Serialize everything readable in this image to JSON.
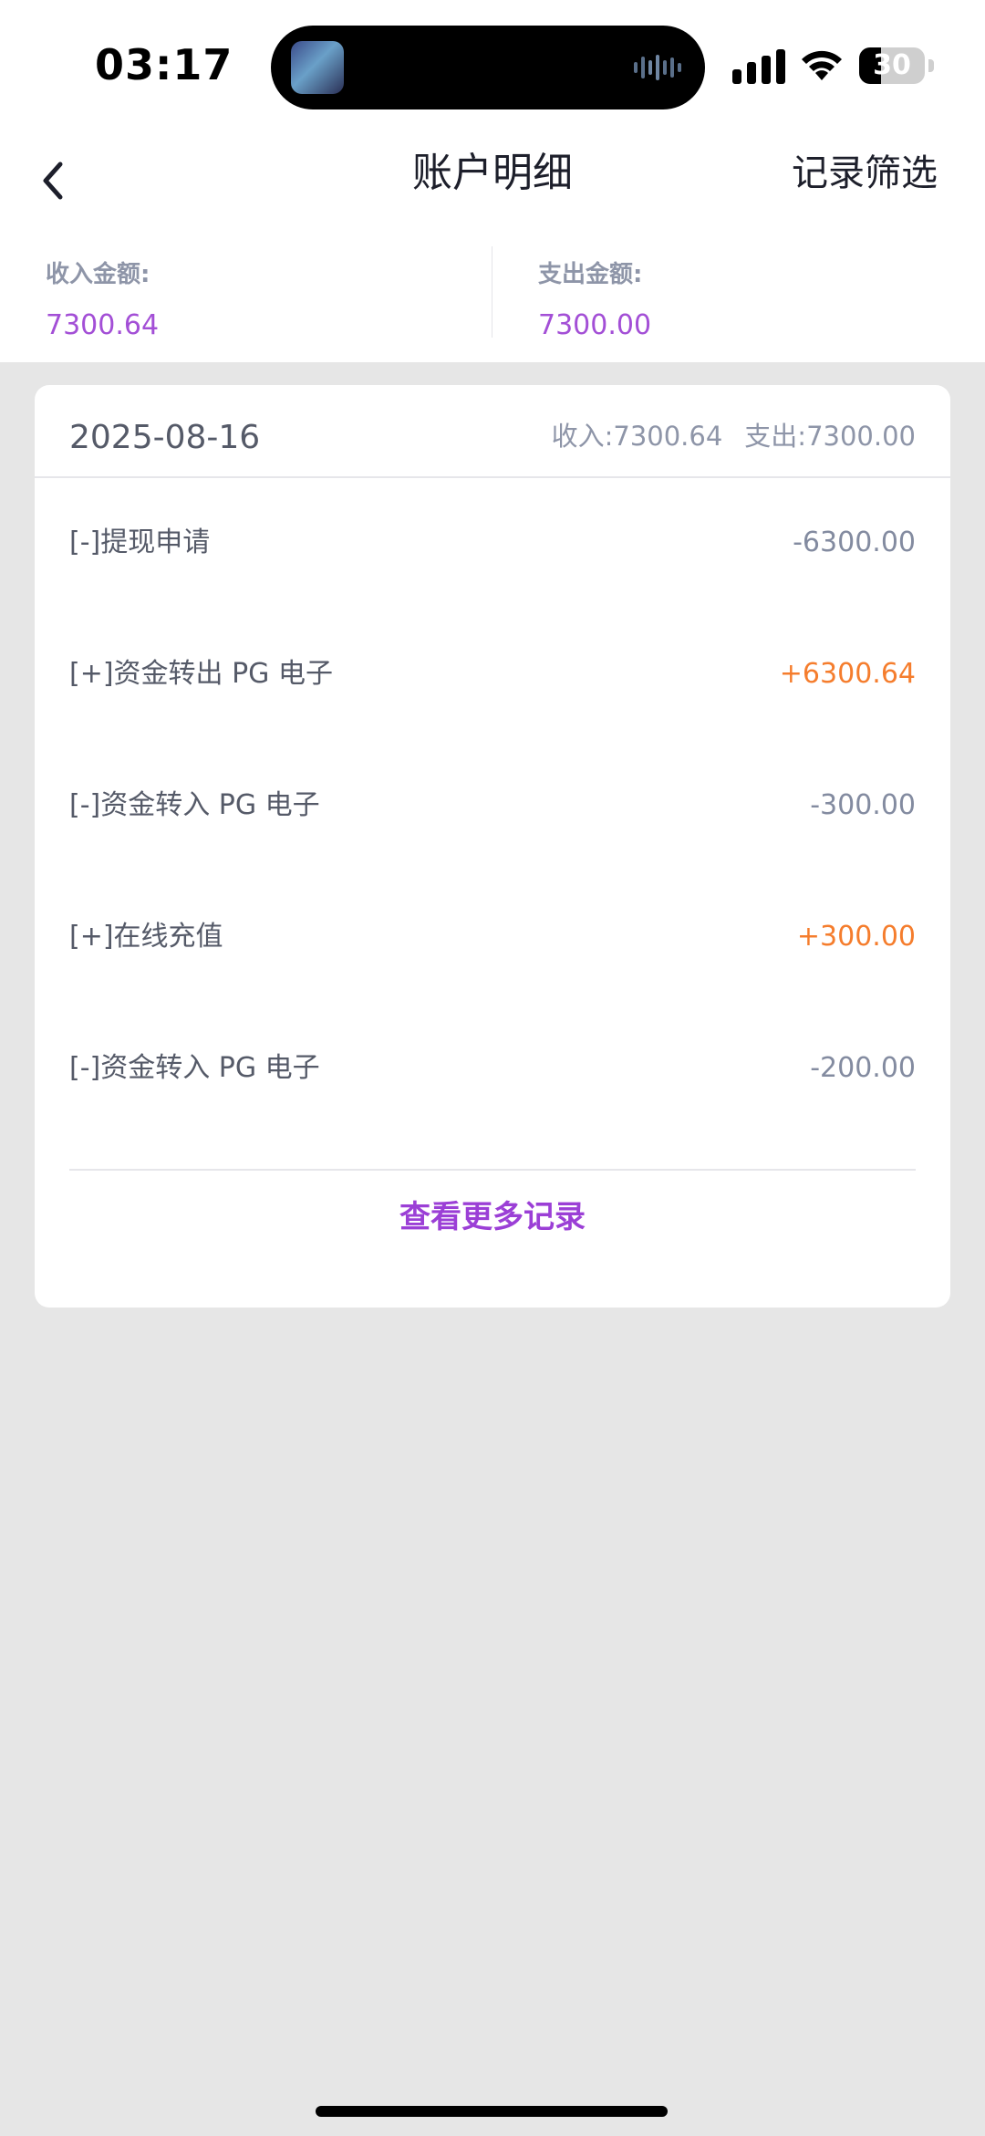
{
  "status_bar": {
    "time": "03:17",
    "battery": "30",
    "icons": [
      "signal-icon",
      "wifi-icon",
      "battery-icon"
    ]
  },
  "nav": {
    "title": "账户明细",
    "filter_label": "记录筛选",
    "back_icon": "chevron-left-icon"
  },
  "summary": {
    "income_label": "收入金额:",
    "income_value": "7300.64",
    "expense_label": "支出金额:",
    "expense_value": "7300.00"
  },
  "card": {
    "date": "2025-08-16",
    "income_total": "收入:7300.64",
    "expense_total": "支出:7300.00",
    "transactions": [
      {
        "label": "[-]提现申请",
        "amount": "-6300.00",
        "type": "neg"
      },
      {
        "label": "[+]资金转出 PG 电子",
        "amount": "+6300.64",
        "type": "pos"
      },
      {
        "label": "[-]资金转入 PG 电子",
        "amount": "-300.00",
        "type": "neg"
      },
      {
        "label": "[+]在线充值",
        "amount": "+300.00",
        "type": "pos"
      },
      {
        "label": "[-]资金转入 PG 电子",
        "amount": "-200.00",
        "type": "neg"
      }
    ],
    "more_label": "查看更多记录"
  },
  "colors": {
    "accent_purple": "#a34fd6",
    "positive_orange": "#f57d2d",
    "negative_gray": "#838ba0",
    "background": "#e6e6e6"
  }
}
